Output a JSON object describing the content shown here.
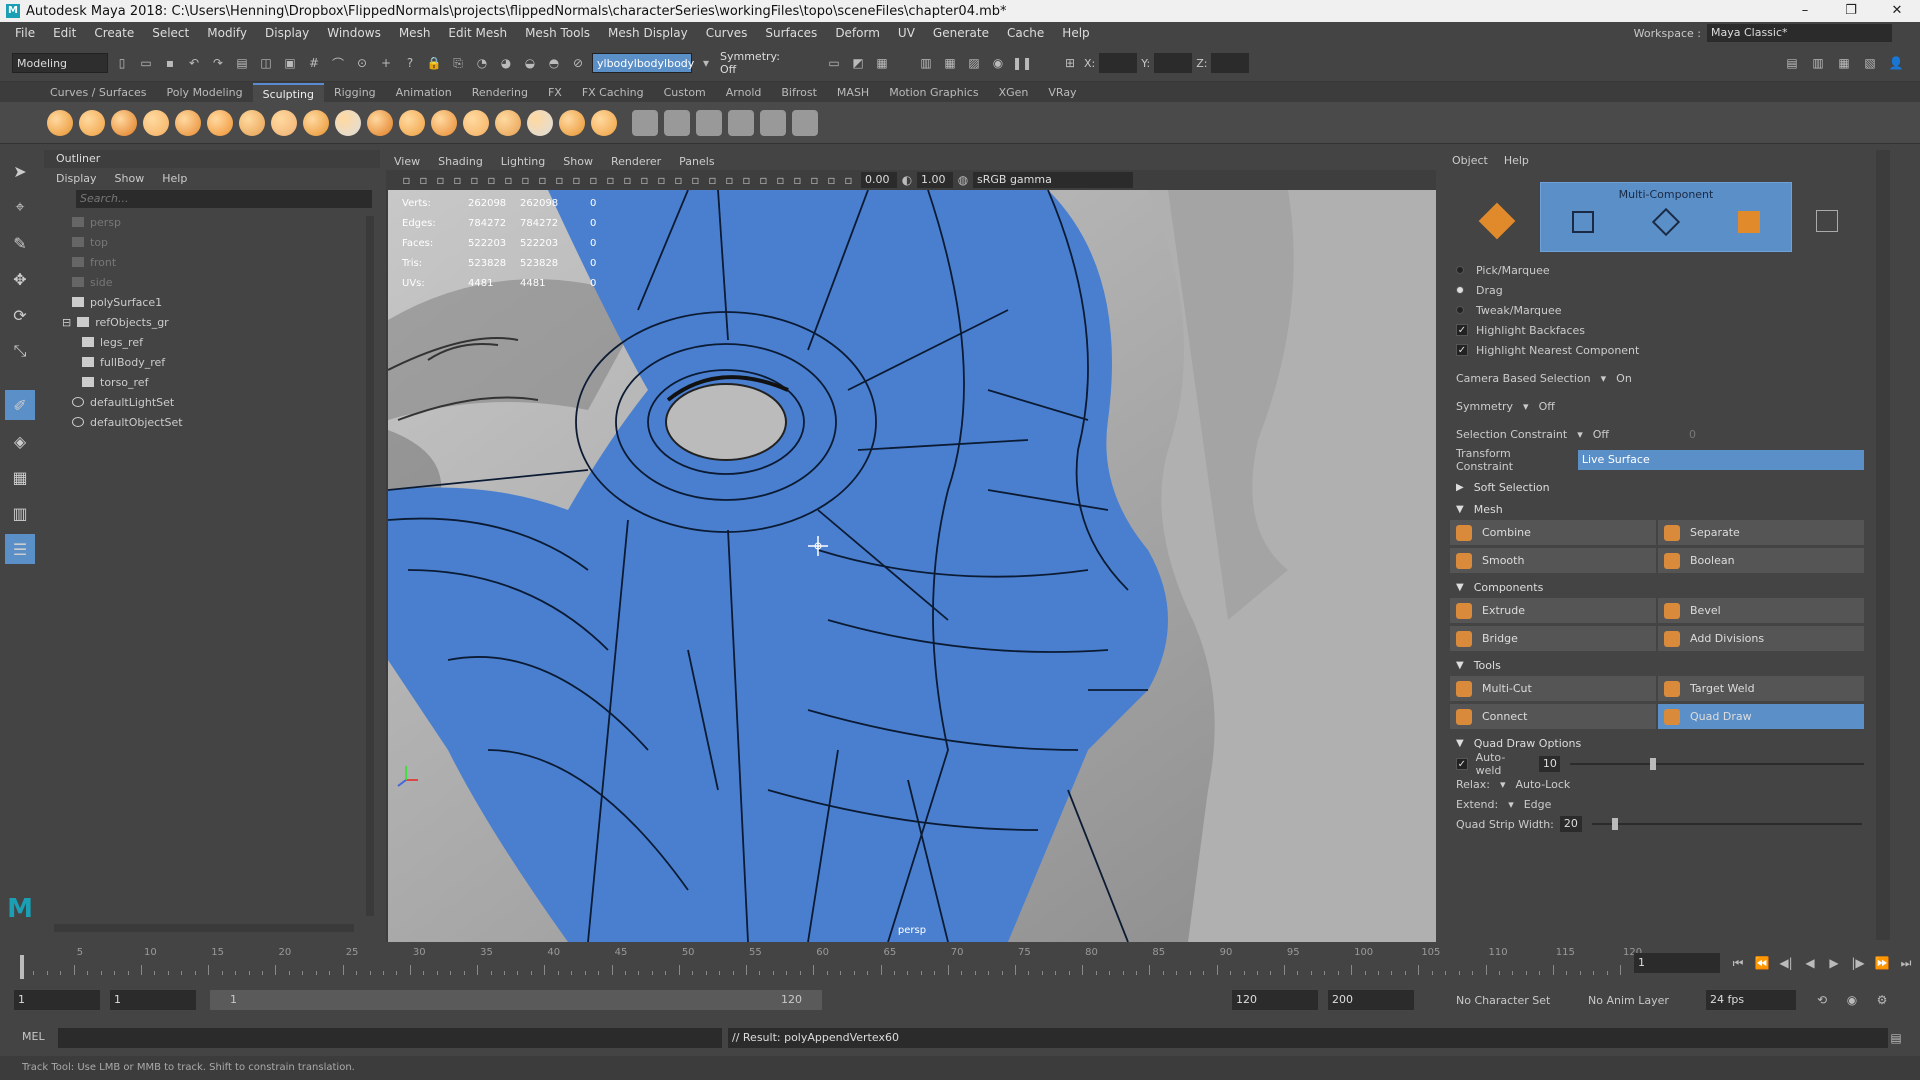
{
  "window": {
    "title": "Autodesk Maya 2018: C:\\Users\\Henning\\Dropbox\\FlippedNormals\\projects\\flippedNormals\\characterSeries\\workingFiles\\topo\\sceneFiles\\chapter04.mb*",
    "logo": "M"
  },
  "menus": [
    "File",
    "Edit",
    "Create",
    "Select",
    "Modify",
    "Display",
    "Windows",
    "Mesh",
    "Edit Mesh",
    "Mesh Tools",
    "Mesh Display",
    "Curves",
    "Surfaces",
    "Deform",
    "UV",
    "Generate",
    "Cache",
    "Help"
  ],
  "workspace": {
    "label": "Workspace :",
    "value": "Maya Classic*"
  },
  "status": {
    "mode": "Modeling",
    "object_field": "ylbodylbodylbody",
    "symmetry": "Symmetry: Off",
    "x_label": "X:",
    "y_label": "Y:",
    "z_label": "Z:"
  },
  "shelf_tabs": [
    "Curves / Surfaces",
    "Poly Modeling",
    "Sculpting",
    "Rigging",
    "Animation",
    "Rendering",
    "FX",
    "FX Caching",
    "Custom",
    "Arnold",
    "Bifrost",
    "MASH",
    "Motion Graphics",
    "XGen",
    "VRay"
  ],
  "active_shelf_tab": "Sculpting",
  "outliner": {
    "title": "Outliner",
    "menu": [
      "Display",
      "Show",
      "Help"
    ],
    "search_placeholder": "Search...",
    "items": [
      {
        "label": "persp",
        "indent": 1,
        "dim": true
      },
      {
        "label": "top",
        "indent": 1,
        "dim": true
      },
      {
        "label": "front",
        "indent": 1,
        "dim": true
      },
      {
        "label": "side",
        "indent": 1,
        "dim": true
      },
      {
        "label": "polySurface1",
        "indent": 1,
        "dim": false
      },
      {
        "label": "refObjects_gr",
        "indent": 0,
        "dim": false
      },
      {
        "label": "legs_ref",
        "indent": 2,
        "dim": false
      },
      {
        "label": "fullBody_ref",
        "indent": 2,
        "dim": false
      },
      {
        "label": "torso_ref",
        "indent": 2,
        "dim": false
      },
      {
        "label": "defaultLightSet",
        "indent": 1,
        "dim": false
      },
      {
        "label": "defaultObjectSet",
        "indent": 1,
        "dim": false
      }
    ]
  },
  "viewport": {
    "menu": [
      "View",
      "Shading",
      "Lighting",
      "Show",
      "Renderer",
      "Panels"
    ],
    "val1": "0.00",
    "val2": "1.00",
    "color_space": "sRGB gamma",
    "camera": "persp",
    "hud": [
      {
        "label": "Verts:",
        "a": "262098",
        "b": "262098",
        "c": "0"
      },
      {
        "label": "Edges:",
        "a": "784272",
        "b": "784272",
        "c": "0"
      },
      {
        "label": "Faces:",
        "a": "522203",
        "b": "522203",
        "c": "0"
      },
      {
        "label": "Tris:",
        "a": "523828",
        "b": "523828",
        "c": "0"
      },
      {
        "label": "UVs:",
        "a": "4481",
        "b": "4481",
        "c": "0"
      }
    ]
  },
  "toolkit": {
    "menu": [
      "Object",
      "Help"
    ],
    "header": "Multi-Component",
    "pick_marquee": "Pick/Marquee",
    "drag": "Drag",
    "tweak_marquee": "Tweak/Marquee",
    "highlight_backfaces": "Highlight Backfaces",
    "highlight_nearest": "Highlight Nearest Component",
    "camera_based_label": "Camera Based Selection",
    "camera_based_value": "On",
    "symmetry_label": "Symmetry",
    "symmetry_value": "Off",
    "sel_constraint_label": "Selection Constraint",
    "sel_constraint_value": "Off",
    "sel_constraint_num": "0",
    "transform_constraint_label": "Transform Constraint",
    "transform_constraint_value": "Live Surface",
    "soft_selection": "Soft Selection",
    "mesh_header": "Mesh",
    "mesh_buttons": [
      [
        "Combine",
        "Separate"
      ],
      [
        "Smooth",
        "Boolean"
      ]
    ],
    "components_header": "Components",
    "component_buttons": [
      [
        "Extrude",
        "Bevel"
      ],
      [
        "Bridge",
        "Add Divisions"
      ]
    ],
    "tools_header": "Tools",
    "tool_buttons": [
      [
        "Multi-Cut",
        "Target Weld"
      ],
      [
        "Connect",
        "Quad Draw"
      ]
    ],
    "quad_draw_options": "Quad Draw Options",
    "autoweld_label": "Auto-weld",
    "autoweld_value": "10",
    "relax_label": "Relax:",
    "relax_value": "Auto-Lock",
    "extend_label": "Extend:",
    "extend_value": "Edge",
    "quad_strip_label": "Quad Strip Width:",
    "quad_strip_value": "20"
  },
  "timeline": {
    "ticks": [
      "5",
      "10",
      "15",
      "20",
      "25",
      "30",
      "35",
      "40",
      "45",
      "50",
      "55",
      "60",
      "65",
      "70",
      "75",
      "80",
      "85",
      "90",
      "95",
      "100",
      "105",
      "110",
      "115",
      "120"
    ],
    "current": "1"
  },
  "range": {
    "start": "1",
    "start2": "1",
    "slider_start": "1",
    "slider_end": "120",
    "end": "120",
    "end2": "200",
    "char_set": "No Character Set",
    "anim_layer": "No Anim Layer",
    "fps": "24 fps"
  },
  "command": {
    "lang": "MEL",
    "result": "// Result: polyAppendVertex60"
  },
  "help_text": "Track Tool: Use LMB or MMB to track. Shift to constrain translation.",
  "colors": {
    "accent": "#5b8fc8",
    "mesh_blue": "#4a7fd0",
    "bg": "#444444"
  }
}
